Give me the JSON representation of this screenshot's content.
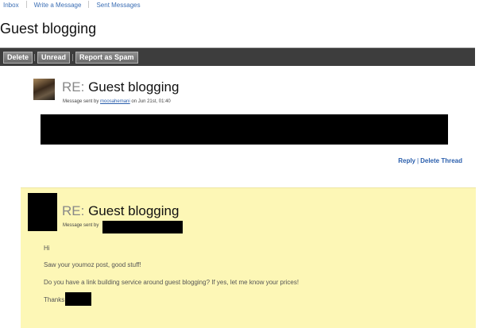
{
  "nav": {
    "inbox": "Inbox",
    "write": "Write a Message",
    "sent": "Sent Messages"
  },
  "page_title": "Guest blogging",
  "toolbar": {
    "delete": "Delete",
    "unread": "Unread",
    "spam": "Report as Spam"
  },
  "message1": {
    "re_prefix": "RE:",
    "subject": "Guest blogging",
    "meta_prefix": "Message sent by",
    "sender": "moosahemani",
    "meta_suffix": "on Jun 21st, 01:40",
    "reply": "Reply",
    "separator": "|",
    "delete_thread": "Delete Thread"
  },
  "message2": {
    "re_prefix": "RE:",
    "subject": "Guest blogging",
    "meta_prefix": "Message sent by",
    "lines": [
      "Hi",
      "Saw your youmoz post, good stuff!",
      "Do you have a link building service around guest blogging? If yes, let me know your prices!",
      "Thanks"
    ]
  },
  "colors": {
    "link": "#2b5fad",
    "toolbar": "#3d3d3d",
    "highlight": "#fdf7b6",
    "redaction": "#000000"
  }
}
